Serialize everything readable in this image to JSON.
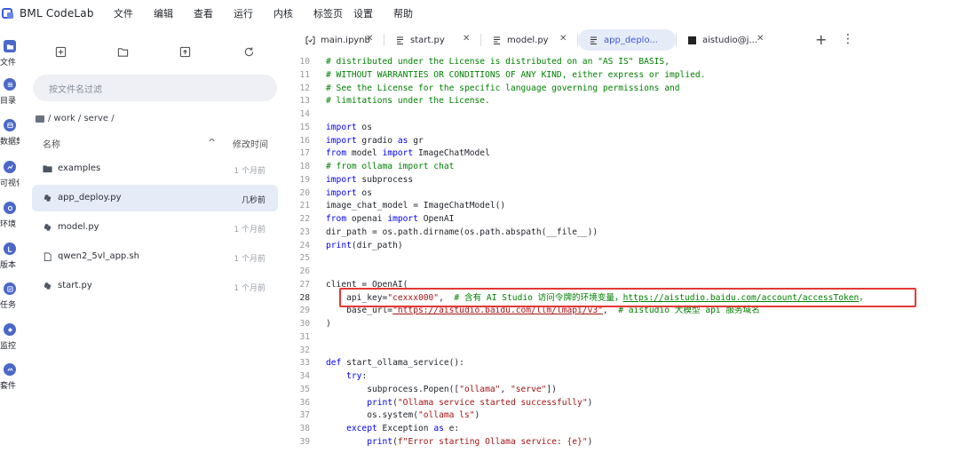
{
  "app": {
    "title": "BML CodeLab"
  },
  "menu": [
    "文件",
    "编辑",
    "查看",
    "运行",
    "内核",
    "标签页",
    "设置",
    "帮助"
  ],
  "activity_bar": [
    {
      "label": "文件",
      "icon": "folder-icon"
    },
    {
      "label": "目录",
      "icon": "list-icon"
    },
    {
      "label": "数据集",
      "icon": "dataset-icon"
    },
    {
      "label": "可视化",
      "icon": "chart-icon"
    },
    {
      "label": "环境",
      "icon": "environment-icon"
    },
    {
      "label": "版本",
      "icon": "version-icon"
    },
    {
      "label": "任务",
      "icon": "task-icon"
    },
    {
      "label": "监控",
      "icon": "monitor-icon"
    },
    {
      "label": "套件",
      "icon": "suite-icon"
    }
  ],
  "explorer": {
    "search_placeholder": "按文件名过滤",
    "breadcrumb": "/ work / serve /",
    "col_name": "名称",
    "col_modified": "修改时间",
    "files": [
      {
        "name": "examples",
        "time": "1 个月前",
        "type": "folder",
        "active": false
      },
      {
        "name": "app_deploy.py",
        "time": "几秒前",
        "type": "python",
        "active": true
      },
      {
        "name": "model.py",
        "time": "1 个月前",
        "type": "python",
        "active": false
      },
      {
        "name": "qwen2_5vl_app.sh",
        "time": "1 个月前",
        "type": "file",
        "active": false
      },
      {
        "name": "start.py",
        "time": "1 个月前",
        "type": "python",
        "active": false
      }
    ]
  },
  "tabs": [
    {
      "label": "main.ipynb",
      "icon": "notebook-icon",
      "active": false
    },
    {
      "label": "start.py",
      "icon": "code-file-icon",
      "active": false
    },
    {
      "label": "model.py",
      "icon": "code-file-icon",
      "active": false
    },
    {
      "label": "app_deplo...",
      "icon": "code-file-icon",
      "active": true
    },
    {
      "label": "aistudio@j...",
      "icon": "terminal-icon",
      "active": false
    }
  ],
  "colors": {
    "accent": "#3b5bdb",
    "highlight_box": "#e53935",
    "active_bg": "#e6ebf8"
  },
  "editor": {
    "current_line": 28,
    "highlighted_line": 28,
    "lines": [
      {
        "n": 10,
        "code": "# distributed under the License is distributed on an \"AS IS\" BASIS,"
      },
      {
        "n": 11,
        "code": "# WITHOUT WARRANTIES OR CONDITIONS OF ANY KIND, either express or implied."
      },
      {
        "n": 12,
        "code": "# See the License for the specific language governing permissions and"
      },
      {
        "n": 13,
        "code": "# limitations under the License."
      },
      {
        "n": 14,
        "code": ""
      },
      {
        "n": 15,
        "code": "import os"
      },
      {
        "n": 16,
        "code": "import gradio as gr"
      },
      {
        "n": 17,
        "code": "from model import ImageChatModel"
      },
      {
        "n": 18,
        "code": "# from ollama import chat"
      },
      {
        "n": 19,
        "code": "import subprocess"
      },
      {
        "n": 20,
        "code": "import os"
      },
      {
        "n": 21,
        "code": "image_chat_model = ImageChatModel()"
      },
      {
        "n": 22,
        "code": "from openai import OpenAI"
      },
      {
        "n": 23,
        "code": "dir_path = os.path.dirname(os.path.abspath(__file__))"
      },
      {
        "n": 24,
        "code": "print(dir_path)"
      },
      {
        "n": 25,
        "code": ""
      },
      {
        "n": 26,
        "code": ""
      },
      {
        "n": 27,
        "code": "client = OpenAI("
      },
      {
        "n": 28,
        "code": "    api_key=\"cexxx000\",  # 含有 AI Studio 访问令牌的环境变量，https://aistudio.baidu.com/account/accessToken，"
      },
      {
        "n": 29,
        "code": "    base_url=\"https://aistudio.baidu.com/llm/lmapi/v3\",  # aistudio 大模型 api 服务域名"
      },
      {
        "n": 30,
        "code": ")"
      },
      {
        "n": 31,
        "code": ""
      },
      {
        "n": 32,
        "code": ""
      },
      {
        "n": 33,
        "code": "def start_ollama_service():"
      },
      {
        "n": 34,
        "code": "    try:"
      },
      {
        "n": 35,
        "code": "        subprocess.Popen([\"ollama\", \"serve\"])"
      },
      {
        "n": 36,
        "code": "        print(\"Ollama service started successfully\")"
      },
      {
        "n": 37,
        "code": "        os.system(\"ollama ls\")"
      },
      {
        "n": 38,
        "code": "    except Exception as e:"
      },
      {
        "n": 39,
        "code": "        print(f\"Error starting Ollama service: {e}\")"
      }
    ]
  }
}
